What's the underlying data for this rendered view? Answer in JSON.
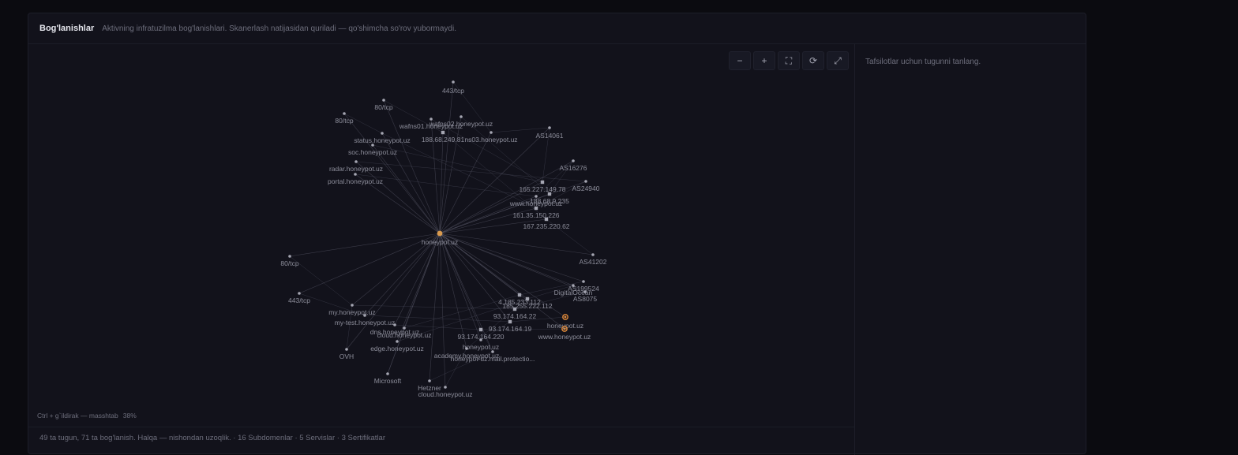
{
  "header": {
    "title": "Bog'lanishlar",
    "subtitle": "Aktivning infratuzilma bog'lanishlari. Skanerlash natijasidan quriladi — qo'shimcha so'rov yubormaydi."
  },
  "toolbar": {
    "zoom_out": "−",
    "zoom_in": "+",
    "fit": "⛶",
    "reset": "⟳",
    "fullscreen": "⤢"
  },
  "hint": {
    "text": "Ctrl + g`ildirak — masshtab",
    "zoom": "38%"
  },
  "footer": {
    "summary": "49 ta tugun, 71 ta bog'lanish. Halqa — nishondan uzoqlik. · 16 Subdomenlar · 5 Servislar · 3 Sertifikatlar"
  },
  "details": {
    "placeholder": "Tafsilotlar uchun tugunni tanlang."
  },
  "graph": {
    "center": "honeypot.uz",
    "nodes": [
      {
        "label": "443/tcp",
        "kind": "service"
      },
      {
        "label": "80/tcp",
        "kind": "service"
      },
      {
        "label": "80/tcp",
        "kind": "service"
      },
      {
        "label": "wafns01.honeypot.uz",
        "kind": "subdomain"
      },
      {
        "label": "wafns02.honeypot.uz",
        "kind": "subdomain"
      },
      {
        "label": "status.honeypot.uz",
        "kind": "subdomain"
      },
      {
        "label": "188.68.249.81",
        "kind": "ip"
      },
      {
        "label": "ns03.honeypot.uz",
        "kind": "subdomain"
      },
      {
        "label": "soc.honeypot.uz",
        "kind": "subdomain"
      },
      {
        "label": "radar.honeypot.uz",
        "kind": "subdomain"
      },
      {
        "label": "portal.honeypot.uz",
        "kind": "subdomain"
      },
      {
        "label": "AS14061",
        "kind": "asn"
      },
      {
        "label": "AS16276",
        "kind": "asn"
      },
      {
        "label": "AS24940",
        "kind": "asn"
      },
      {
        "label": "165.227.149.78",
        "kind": "ip"
      },
      {
        "label": "www.honeypot.uz",
        "kind": "subdomain"
      },
      {
        "label": "188.68.9.235",
        "kind": "ip"
      },
      {
        "label": "161.35.150.226",
        "kind": "ip"
      },
      {
        "label": "167.235.220.62",
        "kind": "ip"
      },
      {
        "label": "80/tcp",
        "kind": "service"
      },
      {
        "label": "AS41202",
        "kind": "asn"
      },
      {
        "label": "AS199524",
        "kind": "asn"
      },
      {
        "label": "DigitalOcean",
        "kind": "provider"
      },
      {
        "label": "AS8075",
        "kind": "asn"
      },
      {
        "label": "443/tcp",
        "kind": "service"
      },
      {
        "label": "4.185.233.112",
        "kind": "ip"
      },
      {
        "label": "185.255.222.112",
        "kind": "ip"
      },
      {
        "label": "93.174.164.22",
        "kind": "ip"
      },
      {
        "label": "93.174.164.19",
        "kind": "ip"
      },
      {
        "label": "93.174.164.220",
        "kind": "ip"
      },
      {
        "label": "honeypot.uz",
        "kind": "certificate"
      },
      {
        "label": "www.honeypot.uz",
        "kind": "certificate"
      },
      {
        "label": "my.honeypot.uz",
        "kind": "subdomain"
      },
      {
        "label": "my-test.honeypot.uz",
        "kind": "subdomain"
      },
      {
        "label": "dns.honeypot.uz",
        "kind": "subdomain"
      },
      {
        "label": "cloud.honeypot.uz",
        "kind": "subdomain"
      },
      {
        "label": "edge.honeypot.uz",
        "kind": "subdomain"
      },
      {
        "label": "honeypot.uz",
        "kind": "subdomain"
      },
      {
        "label": "honeypot-uz.mail.protectio...",
        "kind": "subdomain"
      },
      {
        "label": "academy.honeypot.uz",
        "kind": "subdomain"
      },
      {
        "label": "OVH",
        "kind": "provider"
      },
      {
        "label": "Microsoft",
        "kind": "provider"
      },
      {
        "label": "Hetzner",
        "kind": "provider"
      },
      {
        "label": "cloud.honeypot.uz",
        "kind": "subdomain"
      }
    ]
  },
  "colors": {
    "center_node": "#d99a4e",
    "selected_node": "#e08a3a",
    "node": "#a5a6b2",
    "edge": "#5c5d6e",
    "background": "#12121b"
  }
}
